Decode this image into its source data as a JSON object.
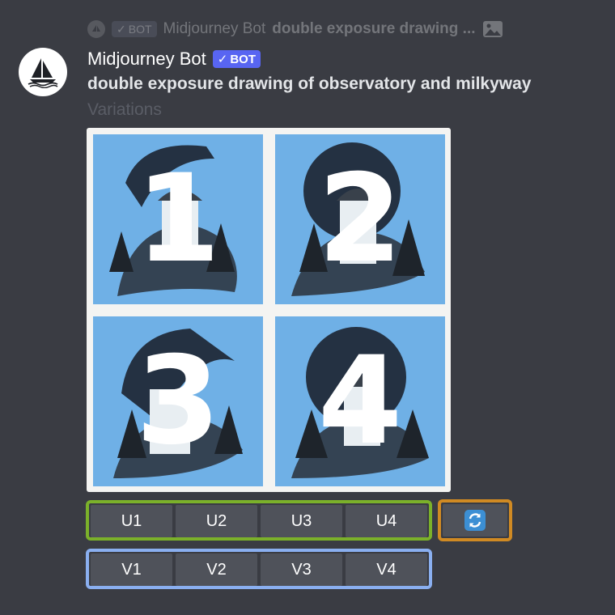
{
  "reply": {
    "bot_badge": "BOT",
    "author": "Midjourney Bot",
    "text": "double exposure drawing ..."
  },
  "message": {
    "author": "Midjourney Bot",
    "bot_badge": "BOT",
    "prompt": "double exposure drawing of observatory and milkyway",
    "subtitle": "Variations"
  },
  "grid": {
    "tiles": [
      {
        "number": "1"
      },
      {
        "number": "2"
      },
      {
        "number": "3"
      },
      {
        "number": "4"
      }
    ]
  },
  "upscale_buttons": [
    "U1",
    "U2",
    "U3",
    "U4"
  ],
  "variation_buttons": [
    "V1",
    "V2",
    "V3",
    "V4"
  ],
  "colors": {
    "background": "#3a3c43",
    "bot_badge": "#5865f2",
    "tile_sky": "#6fb0e6",
    "upscale_outline": "#7bb12a",
    "variation_outline": "#8aaff0",
    "reroll_outline": "#d08a23",
    "reroll_icon": "#3c8fd4"
  },
  "icons": {
    "reroll": "refresh-icon",
    "reply_attachment": "image-icon",
    "avatar": "sailboat-logo"
  }
}
